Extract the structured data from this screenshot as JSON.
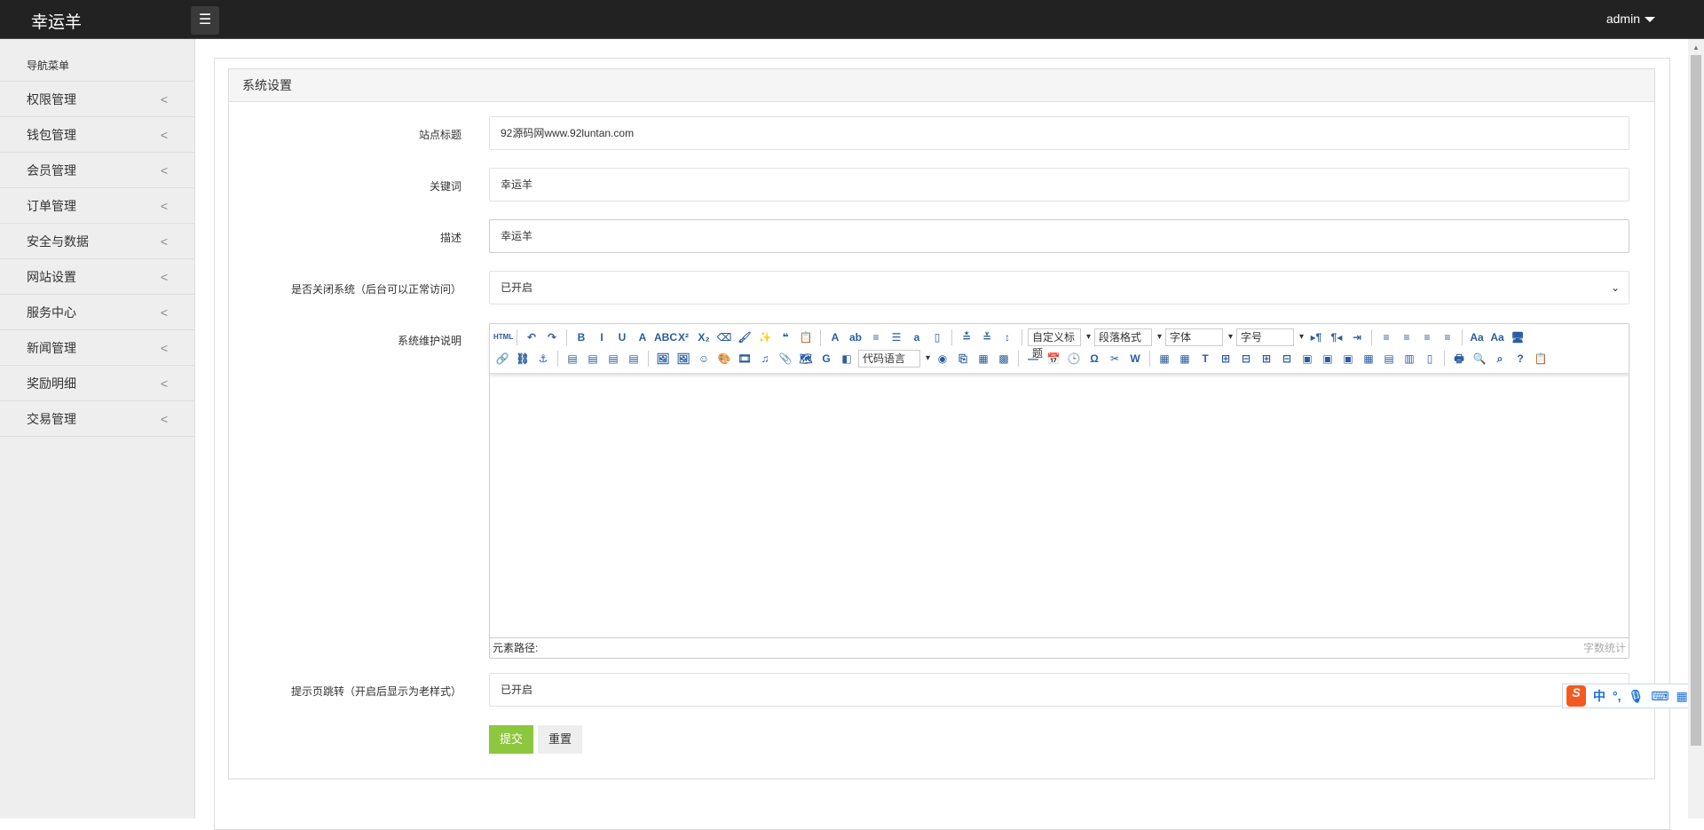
{
  "header": {
    "logo": "幸运羊",
    "menu_icon": "☰",
    "user": "admin"
  },
  "sidebar": {
    "title": "导航菜单",
    "items": [
      {
        "label": "权限管理"
      },
      {
        "label": "钱包管理"
      },
      {
        "label": "会员管理"
      },
      {
        "label": "订单管理"
      },
      {
        "label": "安全与数据"
      },
      {
        "label": "网站设置"
      },
      {
        "label": "服务中心"
      },
      {
        "label": "新闻管理"
      },
      {
        "label": "奖励明细"
      },
      {
        "label": "交易管理"
      }
    ]
  },
  "panel": {
    "title": "系统设置"
  },
  "form": {
    "site_title": {
      "label": "站点标题",
      "value": "92源码网www.92luntan.com"
    },
    "keywords": {
      "label": "关键词",
      "value": "幸运羊"
    },
    "description": {
      "label": "描述",
      "value": "幸运羊"
    },
    "close_system": {
      "label": "是否关闭系统（后台可以正常访问）",
      "value": "已开启"
    },
    "maintenance": {
      "label": "系统维护说明"
    },
    "redirect": {
      "label": "提示页跳转（开启后显示为老样式）",
      "value": "已开启"
    },
    "submit": "提交",
    "reset": "重置"
  },
  "editor": {
    "row1": [
      {
        "n": "html",
        "g": "HTML"
      },
      "sep",
      {
        "n": "undo",
        "g": "↶"
      },
      {
        "n": "redo",
        "g": "↷"
      },
      "sep",
      {
        "n": "bold",
        "g": "B"
      },
      {
        "n": "italic",
        "g": "I"
      },
      {
        "n": "underline",
        "g": "U"
      },
      {
        "n": "font-border",
        "g": "A"
      },
      {
        "n": "strikethrough",
        "g": "ABC"
      },
      {
        "n": "superscript",
        "g": "X²"
      },
      {
        "n": "subscript",
        "g": "X₂"
      },
      {
        "n": "eraser",
        "g": "⌫"
      },
      {
        "n": "format-brush",
        "g": "🖌"
      },
      {
        "n": "auto-format",
        "g": "✨"
      },
      {
        "n": "blockquote",
        "g": "❝"
      },
      {
        "n": "paste-plain",
        "g": "📋"
      },
      "sep",
      {
        "n": "font-color",
        "g": "A"
      },
      {
        "n": "back-color",
        "g": "ab"
      },
      {
        "n": "ordered-list",
        "g": "≡"
      },
      {
        "n": "unordered-list",
        "g": "☰"
      },
      {
        "n": "select-all",
        "g": "a"
      },
      {
        "n": "clear-doc",
        "g": "▯"
      },
      "sep",
      {
        "n": "row-spacing-top",
        "g": "≛"
      },
      {
        "n": "row-spacing-bottom",
        "g": "≚"
      },
      {
        "n": "line-height",
        "g": "↕"
      },
      "sep"
    ],
    "dropdowns": [
      "自定义标题",
      "段落格式",
      "字体",
      "字号"
    ],
    "row1b": [
      {
        "n": "ltr",
        "g": "▸¶"
      },
      {
        "n": "rtl",
        "g": "¶◂"
      },
      {
        "n": "indent",
        "g": "⇥"
      },
      "sep",
      {
        "n": "align-left",
        "g": "≡"
      },
      {
        "n": "align-center",
        "g": "≡"
      },
      {
        "n": "align-right",
        "g": "≡"
      },
      {
        "n": "align-justify",
        "g": "≡"
      },
      "sep",
      {
        "n": "to-upper",
        "g": "Aa"
      },
      {
        "n": "to-lower",
        "g": "Aa"
      },
      {
        "n": "fullscreen",
        "g": "🖥"
      }
    ],
    "row2a": [
      {
        "n": "link",
        "g": "🔗"
      },
      {
        "n": "unlink",
        "g": "⛓"
      },
      {
        "n": "anchor",
        "g": "⚓"
      },
      "sep",
      {
        "n": "image-none",
        "g": "▤"
      },
      {
        "n": "image-left",
        "g": "▤"
      },
      {
        "n": "image-right",
        "g": "▤"
      },
      {
        "n": "image-center",
        "g": "▤"
      },
      "sep",
      {
        "n": "simple-upload",
        "g": "🖼"
      },
      {
        "n": "multi-image",
        "g": "🖼"
      },
      {
        "n": "emotion",
        "g": "☺"
      },
      {
        "n": "scrawl",
        "g": "🎨"
      },
      {
        "n": "video",
        "g": "🎞"
      },
      {
        "n": "music",
        "g": "♫"
      },
      {
        "n": "attachment",
        "g": "📎"
      },
      {
        "n": "map",
        "g": "🗺"
      },
      {
        "n": "gmap",
        "g": "G"
      },
      {
        "n": "iframe",
        "g": "◧"
      }
    ],
    "code_language": "代码语言",
    "row2b": [
      {
        "n": "webapp",
        "g": "◉"
      },
      {
        "n": "pagebreak",
        "g": "⎘"
      },
      {
        "n": "template",
        "g": "▦"
      },
      {
        "n": "background",
        "g": "▩"
      },
      "sep",
      {
        "n": "horizontal-rule",
        "g": "—"
      },
      {
        "n": "date",
        "g": "📅"
      },
      {
        "n": "time",
        "g": "🕒"
      },
      {
        "n": "special-chars",
        "g": "Ω"
      },
      {
        "n": "snapscreen",
        "g": "✂"
      },
      {
        "n": "word-image",
        "g": "W"
      },
      "sep",
      {
        "n": "insert-table",
        "g": "▦"
      },
      {
        "n": "delete-table",
        "g": "▦"
      },
      {
        "n": "caption",
        "g": "T"
      },
      {
        "n": "insert-row",
        "g": "⊞"
      },
      {
        "n": "delete-row",
        "g": "⊟"
      },
      {
        "n": "insert-col",
        "g": "⊞"
      },
      {
        "n": "delete-col",
        "g": "⊟"
      },
      {
        "n": "merge-cells",
        "g": "▣"
      },
      {
        "n": "merge-right",
        "g": "▣"
      },
      {
        "n": "merge-down",
        "g": "▣"
      },
      {
        "n": "split-cells",
        "g": "▦"
      },
      {
        "n": "split-rows",
        "g": "▤"
      },
      {
        "n": "split-cols",
        "g": "▥"
      },
      {
        "n": "chart",
        "g": "▯"
      },
      "sep",
      {
        "n": "print",
        "g": "🖶"
      },
      {
        "n": "preview",
        "g": "🔍"
      },
      {
        "n": "search-replace",
        "g": "⌕"
      },
      {
        "n": "help",
        "g": "?"
      },
      {
        "n": "draft",
        "g": "📋"
      }
    ],
    "element_path": "元素路径:",
    "word_count": "字数统计"
  },
  "ime": {
    "logo": "S",
    "mode": "中",
    "punct": "°,",
    "mic": "🎙",
    "keyboard": "⌨",
    "menu": "▦"
  }
}
